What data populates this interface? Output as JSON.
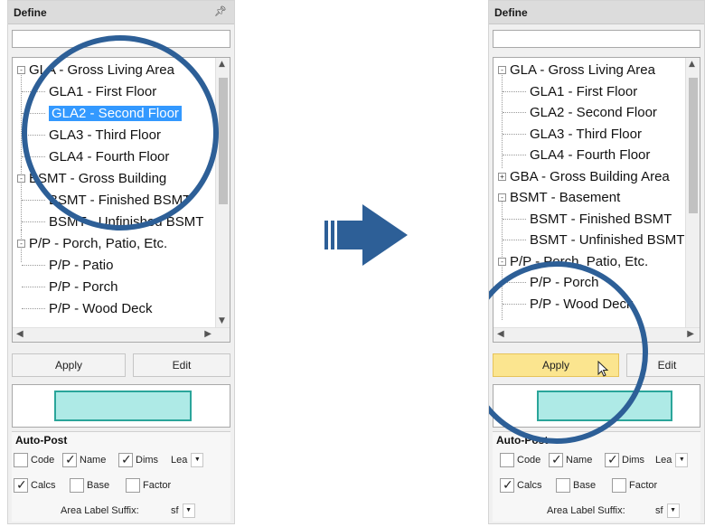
{
  "left_panel": {
    "title": "Define",
    "pin_icon": "pin-icon",
    "tree": [
      {
        "label": "GLA - Gross Living Area",
        "level": 0,
        "expander": "-",
        "state": "normal"
      },
      {
        "label": "GLA1 - First Floor",
        "level": 1,
        "state": "normal"
      },
      {
        "label": "GLA2 - Second Floor",
        "level": 1,
        "state": "selected"
      },
      {
        "label": "GLA3 - Third Floor",
        "level": 1,
        "state": "normal"
      },
      {
        "label": "GLA4 - Fourth Floor",
        "level": 1,
        "state": "normal"
      },
      {
        "label": "BSMT - Gross Building",
        "level": 0,
        "expander": "-",
        "state": "normal"
      },
      {
        "label": "BSMT - Finished BSMT",
        "level": 1,
        "state": "normal"
      },
      {
        "label": "BSMT - Unfinished BSMT",
        "level": 1,
        "state": "normal"
      },
      {
        "label": "P/P - Porch, Patio, Etc.",
        "level": 0,
        "expander": "-",
        "state": "normal"
      },
      {
        "label": "P/P - Patio",
        "level": 1,
        "state": "normal"
      },
      {
        "label": "P/P - Porch",
        "level": 1,
        "state": "normal"
      },
      {
        "label": "P/P - Wood Deck",
        "level": 1,
        "state": "normal"
      }
    ],
    "apply_label": "Apply",
    "edit_label": "Edit",
    "color": "#aeeae6",
    "auto_post": {
      "title": "Auto-Post",
      "code_label": "Code",
      "code_checked": false,
      "name_label": "Name",
      "name_checked": true,
      "dims_label": "Dims",
      "dims_checked": true,
      "lea_value": "Lea",
      "calcs_label": "Calcs",
      "calcs_checked": true,
      "base_label": "Base",
      "base_checked": false,
      "factor_label": "Factor",
      "factor_checked": false,
      "suffix_label": "Area Label Suffix:",
      "suffix_value": "sf"
    }
  },
  "right_panel": {
    "title": "Define",
    "tree": [
      {
        "label": "GLA - Gross Living Area",
        "level": 0,
        "expander": "-"
      },
      {
        "label": "GLA1 - First Floor",
        "level": 1
      },
      {
        "label": "GLA2 - Second Floor",
        "level": 1
      },
      {
        "label": "GLA3 - Third Floor",
        "level": 1
      },
      {
        "label": "GLA4 - Fourth Floor",
        "level": 1
      },
      {
        "label": "GBA - Gross Building Area",
        "level": 0,
        "expander": "+"
      },
      {
        "label": "BSMT - Basement",
        "level": 0,
        "expander": "-"
      },
      {
        "label": "BSMT - Finished BSMT",
        "level": 1
      },
      {
        "label": "BSMT - Unfinished BSMT",
        "level": 1
      },
      {
        "label": "P/P - Porch, Patio, Etc.",
        "level": 0,
        "expander": "-"
      },
      {
        "label": "P/P - Porch",
        "level": 1
      },
      {
        "label": "P/P - Wood Deck",
        "level": 1
      }
    ],
    "apply_label": "Apply",
    "edit_label": "Edit",
    "auto_post": {
      "title": "Auto-Post",
      "code_label": "Code",
      "name_label": "Name",
      "dims_label": "Dims",
      "lea_value": "Lea",
      "calcs_label": "Calcs",
      "base_label": "Base",
      "factor_label": "Factor",
      "suffix_label": "Area Label Suffix:",
      "suffix_value": "sf"
    }
  },
  "colors": {
    "accent_selection": "#3399ff",
    "highlight_circle": "#2d5f97",
    "apply_hover": "#fbe58f",
    "arrow": "#2d5f97"
  },
  "icons": {
    "arrow": "right-arrow-icon",
    "cursor": "mouse-pointer-icon"
  }
}
